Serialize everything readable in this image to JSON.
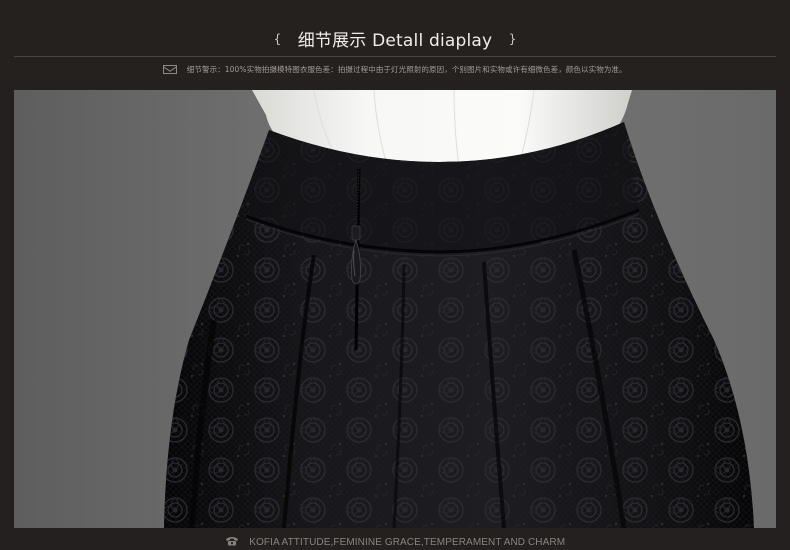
{
  "header": {
    "open_brace": "{",
    "title": "细节展示 Detall diaplay",
    "close_brace": "}"
  },
  "notice": {
    "icon": "mail-icon",
    "text": "细节警示：100%实物拍摄模特图衣服色差：拍摄过程中由于灯光照射的原因，个别图片和实物或许有细微色差，颜色以实物为准。"
  },
  "photo": {
    "subject": "black lace skirt waistband with zipper and white blouse"
  },
  "footer": {
    "icon": "phone-icon",
    "text": "KOFIA ATTITUDE,FEMININE GRACE,TEMPERAMENT AND CHARM"
  },
  "colors": {
    "background": "#24201f",
    "skirt": "#0d0d10",
    "backdrop": "#6e6e6e",
    "blouse": "#f1f1ef"
  }
}
